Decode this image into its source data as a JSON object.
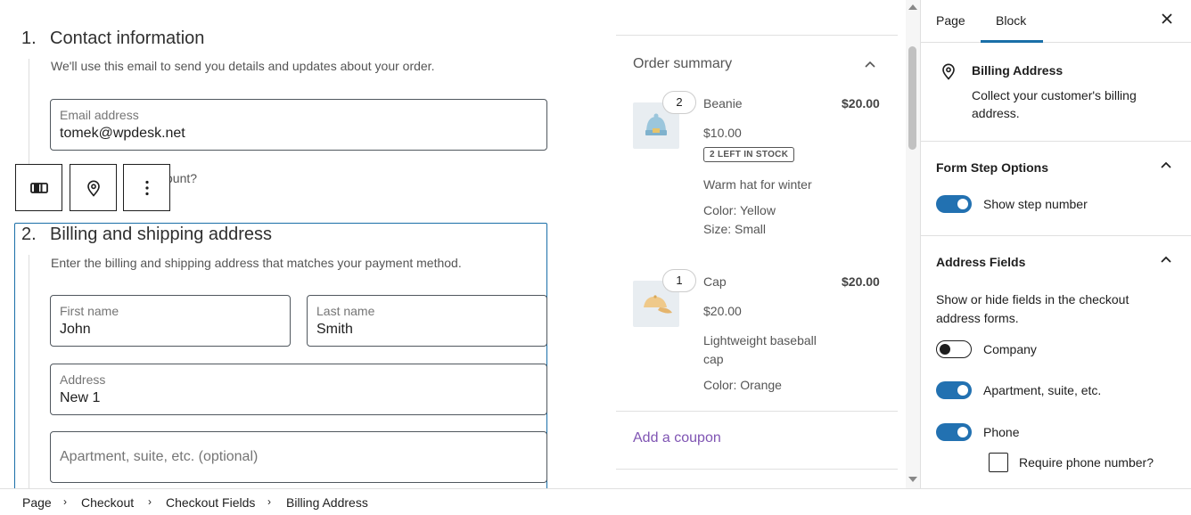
{
  "checkout": {
    "contact": {
      "number": "1.",
      "title": "Contact information",
      "description": "We'll use this email to send you details and updates about your order.",
      "email_label": "Email address",
      "email_value": "tomek@wpdesk.net",
      "account_text_partial": "ount?"
    },
    "billing": {
      "number": "2.",
      "title": "Billing and shipping address",
      "description": "Enter the billing and shipping address that matches your payment method.",
      "first_name_label": "First name",
      "first_name_value": "John",
      "last_name_label": "Last name",
      "last_name_value": "Smith",
      "address_label": "Address",
      "address_value": "New 1",
      "apartment_placeholder": "Apartment, suite, etc. (optional)"
    }
  },
  "block_toolbar": {
    "icons": [
      "block-type-icon",
      "location-pin-icon",
      "more-options-icon"
    ]
  },
  "order_summary": {
    "title": "Order summary",
    "items": [
      {
        "qty": "2",
        "name": "Beanie",
        "total": "$20.00",
        "unit_price": "$10.00",
        "stock": "2 LEFT IN STOCK",
        "description": "Warm hat for winter",
        "attr1": "Color: Yellow",
        "attr2": "Size: Small"
      },
      {
        "qty": "1",
        "name": "Cap",
        "total": "$20.00",
        "unit_price": "$20.00",
        "description_line1": "Lightweight baseball",
        "description_line2": "cap",
        "attr1": "Color: Orange"
      }
    ],
    "coupon_link": "Add a coupon"
  },
  "inspector": {
    "tab_page": "Page",
    "tab_block": "Block",
    "block_card": {
      "title": "Billing Address",
      "description_line1": "Collect your customer's billing",
      "description_line2": "address."
    },
    "form_step_options": {
      "title": "Form Step Options",
      "show_step_number": "Show step number",
      "show_step_number_on": true
    },
    "address_fields": {
      "title": "Address Fields",
      "description_line1": "Show or hide fields in the checkout",
      "description_line2": "address forms.",
      "company": "Company",
      "company_on": false,
      "apartment": "Apartment, suite, etc.",
      "apartment_on": true,
      "phone": "Phone",
      "phone_on": true,
      "require_phone": "Require phone number?",
      "require_phone_checked": false
    }
  },
  "breadcrumbs": [
    "Page",
    "Checkout",
    "Checkout Fields",
    "Billing Address"
  ],
  "colors": {
    "accent": "#2271b1",
    "coupon_link": "#7f54b3",
    "selected_block_border": "#1a6fa8"
  }
}
